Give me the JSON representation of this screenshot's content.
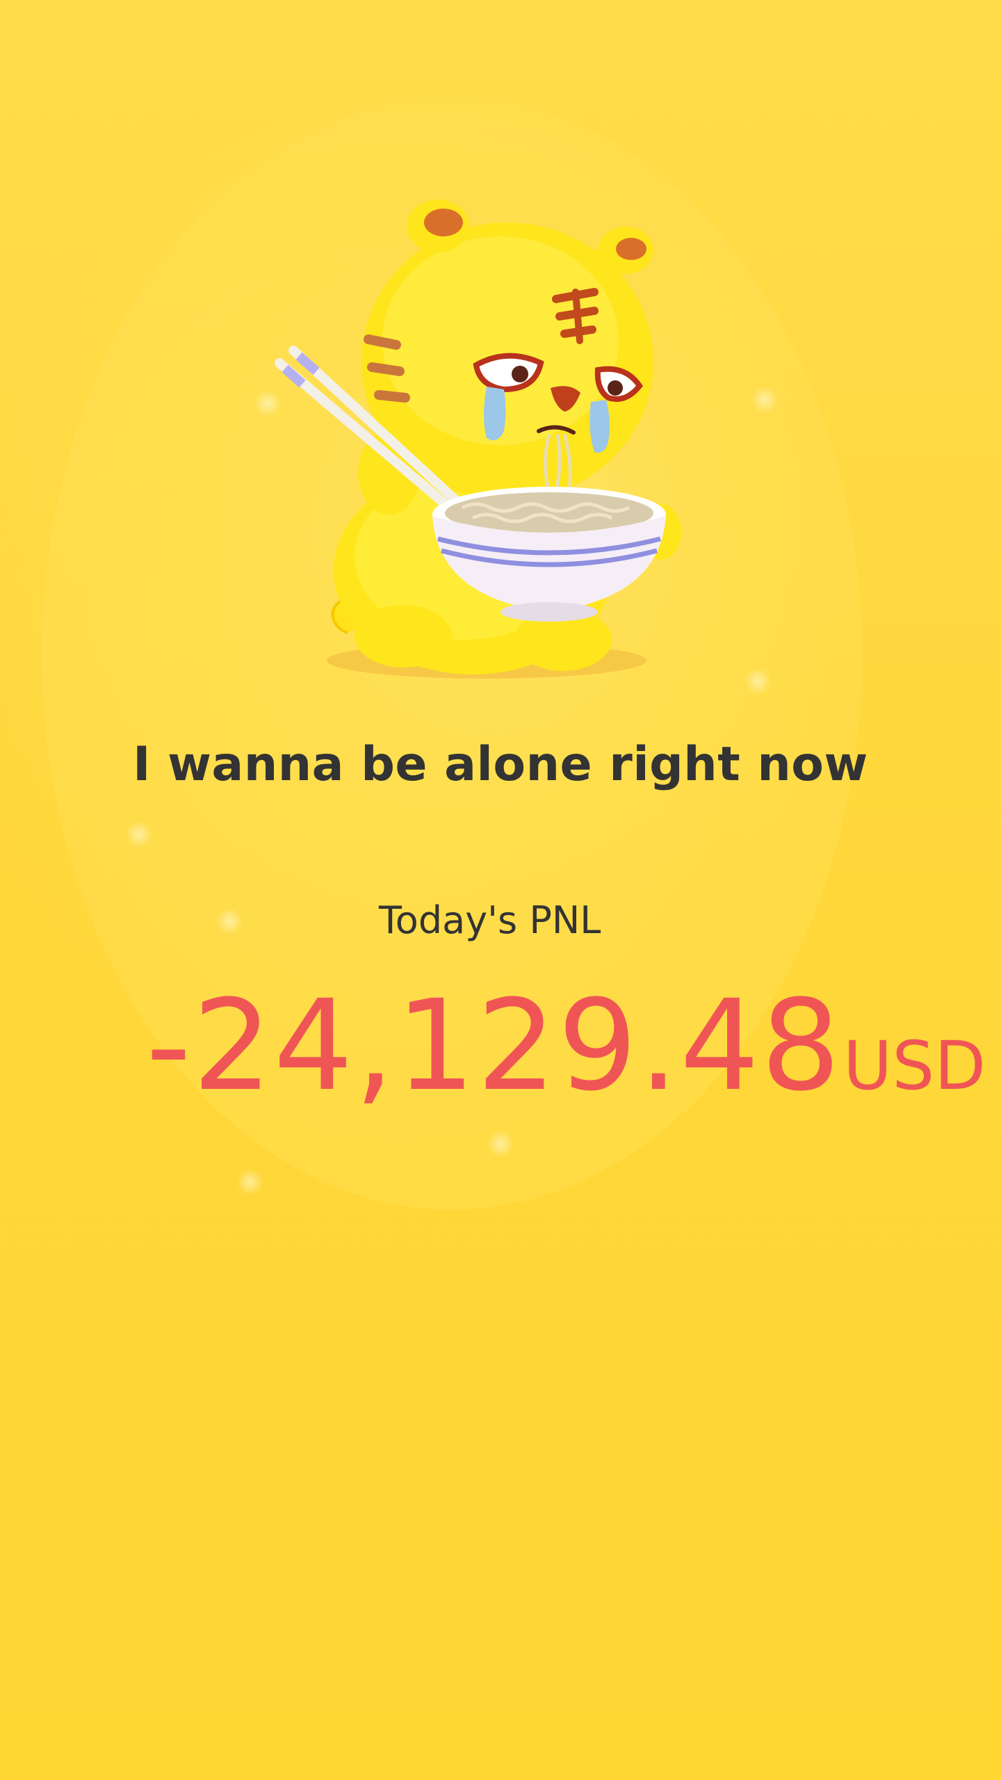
{
  "status": {
    "title": "I wanna be alone right now"
  },
  "pnl": {
    "label": "Today's PNL",
    "value": "-24,129.48",
    "currency": "USD"
  },
  "mascot": {
    "icon": "crying-tiger-eating-noodles-icon"
  },
  "colors": {
    "background": "#ffd83d",
    "text": "#333333",
    "loss": "#f05556"
  }
}
